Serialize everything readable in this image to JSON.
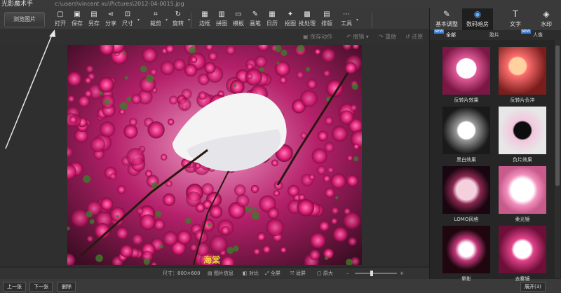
{
  "window": {
    "app_title": "光影魔术手",
    "path": "c:\\users\\vincent xu\\Pictures\\2012-04-0015.jpg"
  },
  "toolbar": {
    "browse_label": "浏览图片",
    "tools": [
      {
        "id": "open",
        "icon": "open-icon",
        "glyph": "▢",
        "label": "打开"
      },
      {
        "id": "save",
        "icon": "save-icon",
        "glyph": "▣",
        "label": "保存"
      },
      {
        "id": "saveas",
        "icon": "saveas-icon",
        "glyph": "▤",
        "label": "另存"
      },
      {
        "id": "share",
        "icon": "share-icon",
        "glyph": "⋖",
        "label": "分享"
      },
      {
        "id": "size",
        "icon": "resize-icon",
        "glyph": "⊡",
        "label": "尺寸"
      },
      {
        "id": "crop",
        "icon": "crop-icon",
        "glyph": "⌗",
        "label": "裁剪"
      },
      {
        "id": "rotate",
        "icon": "rotate-icon",
        "glyph": "↻",
        "label": "旋转"
      },
      {
        "id": "border",
        "icon": "border-icon",
        "glyph": "▦",
        "label": "边框"
      },
      {
        "id": "collage",
        "icon": "collage-icon",
        "glyph": "▥",
        "label": "拼图"
      },
      {
        "id": "template",
        "icon": "template-icon",
        "glyph": "▭",
        "label": "模板"
      },
      {
        "id": "brush",
        "icon": "brush-icon",
        "glyph": "✎",
        "label": "画笔"
      },
      {
        "id": "calendar",
        "icon": "calendar-icon",
        "glyph": "▦",
        "label": "日历"
      },
      {
        "id": "cutout",
        "icon": "cutout-icon",
        "glyph": "✦",
        "label": "抠图"
      },
      {
        "id": "batch",
        "icon": "batch-icon",
        "glyph": "▩",
        "label": "批处理"
      },
      {
        "id": "layout",
        "icon": "layout-icon",
        "glyph": "▤",
        "label": "排版"
      },
      {
        "id": "tools",
        "icon": "more-icon",
        "glyph": "⋯",
        "label": "工具"
      }
    ],
    "sub": {
      "save_action": "保存动作",
      "undo": "撤销",
      "redo": "重做",
      "restore": "还原"
    }
  },
  "status": {
    "size": "尺寸：800×600",
    "info": "图片信息",
    "compare": "对比",
    "fullscreen": "全屏",
    "fit": "适屏",
    "zoom": "原大"
  },
  "photo": {
    "caption": "海棠"
  },
  "bottom": {
    "prev": "上一张",
    "next": "下一张",
    "delete": "删除",
    "expand": "展开(3)"
  },
  "right_panel": {
    "tabs": [
      {
        "id": "basic",
        "icon": "adjust-icon",
        "glyph": "✎",
        "label": "基本调整",
        "active": false
      },
      {
        "id": "digital",
        "icon": "camera-icon",
        "glyph": "◉",
        "label": "数码暗房",
        "active": true
      },
      {
        "id": "text",
        "icon": "text-icon",
        "glyph": "T",
        "label": "文字",
        "active": false
      },
      {
        "id": "watermark",
        "icon": "watermark-icon",
        "glyph": "◈",
        "label": "水印",
        "active": false
      }
    ],
    "sub_tabs": [
      {
        "label": "全部",
        "active": true,
        "new": true
      },
      {
        "label": "胶片",
        "active": false,
        "new": false
      },
      {
        "label": "人像",
        "active": false,
        "new": true
      }
    ],
    "new_tag": "NEW",
    "effects": [
      "反转片效果",
      "反转片负冲",
      "黑白效果",
      "负片效果",
      "LOMO风格",
      "柔光镜",
      "晕影",
      "去雾镜"
    ]
  },
  "colors": {
    "accent": "#5fb0ff",
    "caption": "#f0d23a"
  }
}
